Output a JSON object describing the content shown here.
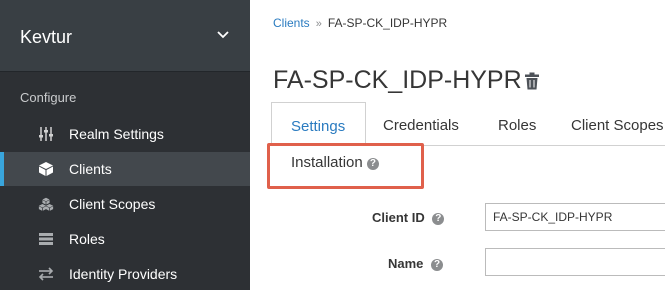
{
  "sidebar": {
    "realm": "Kevtur",
    "section": "Configure",
    "items": [
      {
        "label": "Realm Settings",
        "icon": "sliders-icon"
      },
      {
        "label": "Clients",
        "icon": "cube-icon",
        "active": true
      },
      {
        "label": "Client Scopes",
        "icon": "cubes-icon"
      },
      {
        "label": "Roles",
        "icon": "list-icon"
      },
      {
        "label": "Identity Providers",
        "icon": "exchange-icon"
      }
    ]
  },
  "breadcrumb": {
    "parent": "Clients",
    "separator": "»",
    "current": "FA-SP-CK_IDP-HYPR"
  },
  "page": {
    "title": "FA-SP-CK_IDP-HYPR"
  },
  "tabs": [
    {
      "label": "Settings",
      "active": true
    },
    {
      "label": "Credentials"
    },
    {
      "label": "Roles"
    },
    {
      "label": "Client Scopes"
    },
    {
      "label": "Installation"
    }
  ],
  "form": {
    "client_id": {
      "label": "Client ID",
      "value": "FA-SP-CK_IDP-HYPR"
    },
    "name": {
      "label": "Name",
      "value": ""
    }
  },
  "help_glyph": "?",
  "colors": {
    "accent": "#2a7bc0",
    "sidebar_bg": "#2d3034",
    "active_indicator": "#39a5dc",
    "highlight": "#e0604b"
  }
}
